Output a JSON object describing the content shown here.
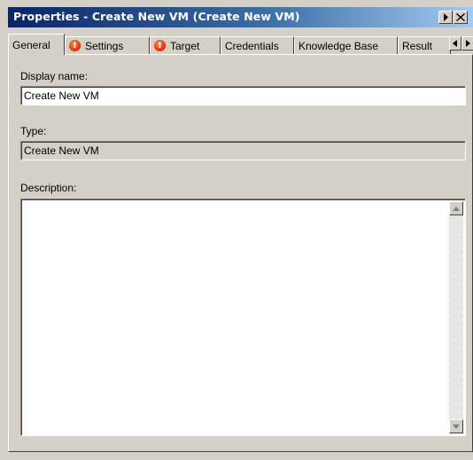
{
  "window": {
    "title": "Properties - Create New VM (Create New VM)",
    "title_buttons": [
      {
        "name": "overflow-arrow",
        "icon": "triangle-right-icon"
      },
      {
        "name": "close",
        "icon": "close-icon"
      }
    ]
  },
  "tabs": [
    {
      "label": "General",
      "active": true,
      "warning": false
    },
    {
      "label": "Settings",
      "active": false,
      "warning": true
    },
    {
      "label": "Target",
      "active": false,
      "warning": true
    },
    {
      "label": "Credentials",
      "active": false,
      "warning": false
    },
    {
      "label": "Knowledge Base",
      "active": false,
      "warning": false
    },
    {
      "label": "Result",
      "active": false,
      "warning": false
    }
  ],
  "form": {
    "display_name_label": "Display name:",
    "display_name_value": "Create New VM",
    "type_label": "Type:",
    "type_value": "Create New VM",
    "description_label": "Description:",
    "description_value": ""
  },
  "colors": {
    "title_gradient_start": "#0a246a",
    "title_gradient_end": "#a6caf0",
    "warning": "#e83a10",
    "face": "#d4d0c8"
  }
}
